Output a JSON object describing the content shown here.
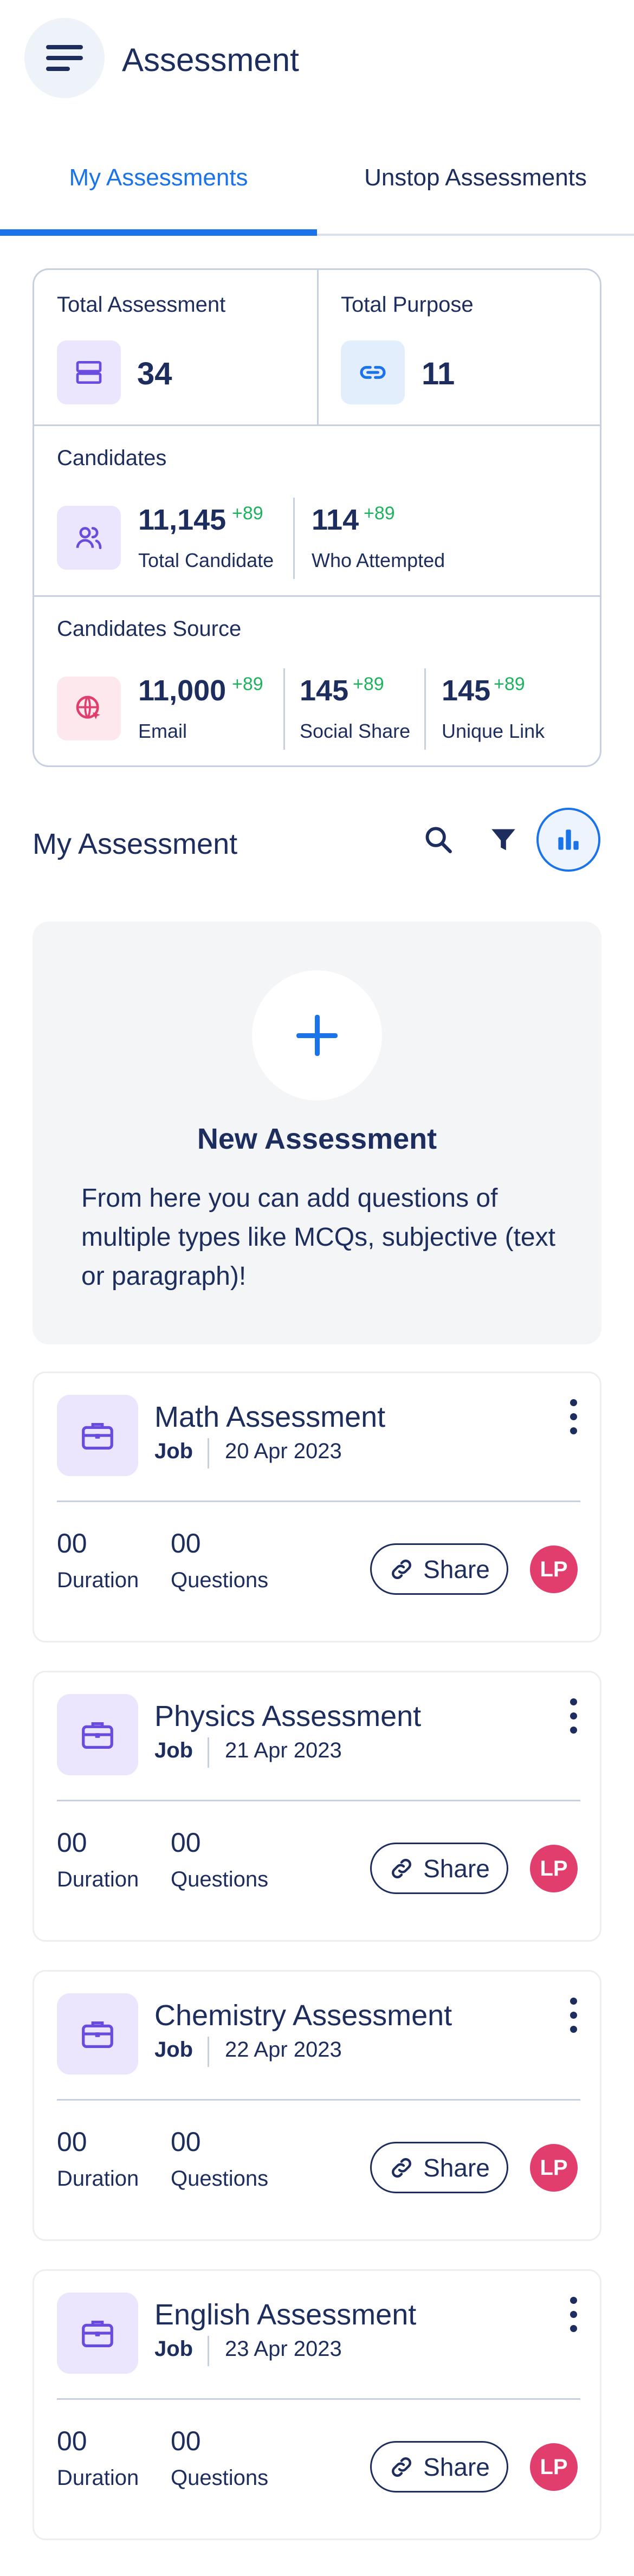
{
  "header": {
    "title": "Assessment",
    "menu_icon": "hamburger-menu-icon"
  },
  "tabs": [
    {
      "label": "My Assessments",
      "active": true
    },
    {
      "label": "Unstop Assessments",
      "active": false
    }
  ],
  "stats": {
    "total_assessment": {
      "label": "Total Assessment",
      "value": "34",
      "icon": "layers-icon"
    },
    "total_purpose": {
      "label": "Total Purpose",
      "value": "11",
      "icon": "link-icon"
    },
    "candidates": {
      "label": "Candidates",
      "icon": "users-icon",
      "total": {
        "value": "11,145",
        "delta": "+89",
        "label": "Total Candidate"
      },
      "attempted": {
        "value": "114",
        "delta": "+89",
        "label": "Who Attempted"
      }
    },
    "sources": {
      "label": "Candidates Source",
      "icon": "globe-pointer-icon",
      "email": {
        "value": "11,000",
        "delta": "+89",
        "label": "Email"
      },
      "social": {
        "value": "145",
        "delta": "+89",
        "label": "Social Share"
      },
      "unique": {
        "value": "145",
        "delta": "+89",
        "label": "Unique Link"
      }
    }
  },
  "section": {
    "title": "My Assessment"
  },
  "new_assessment": {
    "title": "New Assessment",
    "description": "From here you can add questions of multiple types like MCQs, subjective (text or paragraph)!"
  },
  "assessments": [
    {
      "title": "Math Assessment",
      "type": "Job",
      "date": "20 Apr 2023",
      "duration": "00",
      "duration_label": "Duration",
      "questions": "00",
      "questions_label": "Questions",
      "share_label": "Share",
      "avatar": "LP"
    },
    {
      "title": "Physics Assessment",
      "type": "Job",
      "date": "21 Apr 2023",
      "duration": "00",
      "duration_label": "Duration",
      "questions": "00",
      "questions_label": "Questions",
      "share_label": "Share",
      "avatar": "LP"
    },
    {
      "title": "Chemistry Assessment",
      "type": "Job",
      "date": "22 Apr 2023",
      "duration": "00",
      "duration_label": "Duration",
      "questions": "00",
      "questions_label": "Questions",
      "share_label": "Share",
      "avatar": "LP"
    },
    {
      "title": "English Assessment",
      "type": "Job",
      "date": "23 Apr 2023",
      "duration": "00",
      "duration_label": "Duration",
      "questions": "00",
      "questions_label": "Questions",
      "share_label": "Share",
      "avatar": "LP"
    }
  ],
  "colors": {
    "accent": "#1a73e8",
    "text": "#1c2d5e",
    "positive": "#20b35f",
    "avatar": "#e13e6e"
  }
}
